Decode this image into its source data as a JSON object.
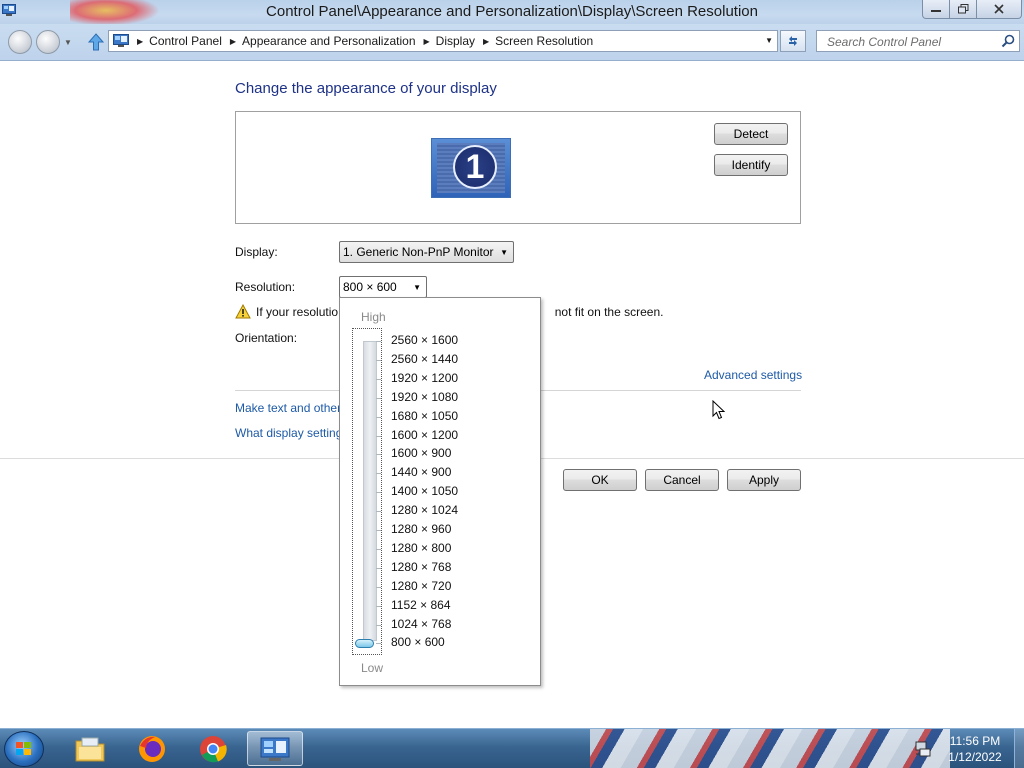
{
  "window": {
    "title": "Control Panel\\Appearance and Personalization\\Display\\Screen Resolution"
  },
  "addressbar": {
    "crumbs": [
      "Control Panel",
      "Appearance and Personalization",
      "Display",
      "Screen Resolution"
    ],
    "search_placeholder": "Search Control Panel"
  },
  "content": {
    "heading": "Change the appearance of your display",
    "monitor_number": "1",
    "detect_label": "Detect",
    "identify_label": "Identify",
    "display_label": "Display:",
    "display_value": "1. Generic Non-PnP Monitor",
    "resolution_label": "Resolution:",
    "resolution_value": "800 × 600",
    "warning_start": "If your resolutio",
    "warning_end": "not fit on the screen.",
    "orientation_label": "Orientation:",
    "advanced_link": "Advanced settings",
    "link_text_size": "Make text and other",
    "link_display_settings": "What display setting",
    "ok_label": "OK",
    "cancel_label": "Cancel",
    "apply_label": "Apply"
  },
  "resolution_popup": {
    "high_label": "High",
    "low_label": "Low",
    "options": [
      "2560 × 1600",
      "2560 × 1440",
      "1920 × 1200",
      "1920 × 1080",
      "1680 × 1050",
      "1600 × 1200",
      "1600 × 900",
      "1440 × 900",
      "1400 × 1050",
      "1280 × 1024",
      "1280 × 960",
      "1280 × 800",
      "1280 × 768",
      "1280 × 720",
      "1152 × 864",
      "1024 × 768",
      "800 × 600"
    ],
    "selected_index": 16
  },
  "taskbar": {
    "apps": [
      "file-explorer-icon",
      "firefox-icon",
      "chrome-icon",
      "control-panel-icon"
    ],
    "time": "11:56 PM",
    "date": "1/12/2022"
  },
  "colors": {
    "heading": "#1e3287",
    "link": "#1e5aa6",
    "titlebar": "#b9d1ea"
  }
}
